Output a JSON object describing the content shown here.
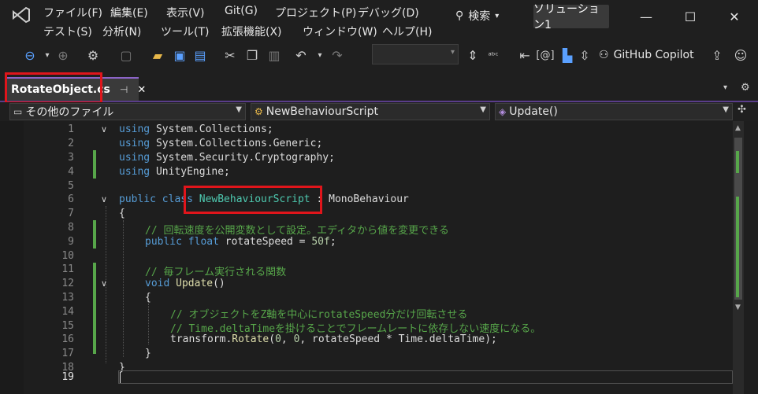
{
  "menu": {
    "row1": [
      "ファイル(F)",
      "編集(E)",
      "表示(V)",
      "Git(G)",
      "プロジェクト(P)",
      "デバッグ(D)"
    ],
    "row2": [
      "テスト(S)",
      "分析(N)",
      "ツール(T)",
      "拡張機能(X)",
      "ウィンドウ(W)",
      "ヘルプ(H)"
    ]
  },
  "search": {
    "label": "検索"
  },
  "solution": {
    "name": "ソリューション1"
  },
  "toolbar": {
    "copilot_label": "GitHub Copilot"
  },
  "tab": {
    "title": "RotateObject.cs",
    "pin": "⊣",
    "close": "✕"
  },
  "nav": {
    "project": "その他のファイル",
    "class": "NewBehaviourScript",
    "member": "Update()"
  },
  "code": {
    "line_numbers": [
      "1",
      "2",
      "3",
      "4",
      "5",
      "6",
      "7",
      "8",
      "9",
      "10",
      "11",
      "12",
      "13",
      "14",
      "15",
      "16",
      "17",
      "18",
      "19"
    ],
    "l1_kw": "using",
    "l1_rest": " System.Collections;",
    "l2_kw": "using",
    "l2_rest": " System.Collections.Generic;",
    "l3_kw": "using",
    "l3_rest": " System.Security.Cryptography;",
    "l4_kw": "using",
    "l4_rest": " UnityEngine;",
    "l6_kw": "public class",
    "l6_type": "NewBehaviourScript",
    "l6_rest": " : MonoBehaviour",
    "l7": "{",
    "l8_comment": "// 回転速度を公開変数として設定。エディタから値を変更できる",
    "l9_kw": "public float",
    "l9_rest": " rotateSpeed = ",
    "l9_num": "50f",
    "l9_end": ";",
    "l11_comment": "// 毎フレーム実行される関数",
    "l12_kw": "void",
    "l12_fn": "Update",
    "l12_rest": "()",
    "l13": "{",
    "l14_comment": "// オブジェクトをZ軸を中心にrotateSpeed分だけ回転させる",
    "l15_comment": "// Time.deltaTimeを掛けることでフレームレートに依存しない速度になる。",
    "l16_a": "transform.",
    "l16_fn": "Rotate",
    "l16_b": "(",
    "l16_n1": "0",
    "l16_c": ", ",
    "l16_n2": "0",
    "l16_d": ", rotateSpeed * Time.deltaTime);",
    "l17": "}",
    "l18": "}"
  },
  "colors": {
    "highlight": "#e0151b",
    "accent": "#8c64c8",
    "change_bar": "#57a64a"
  }
}
